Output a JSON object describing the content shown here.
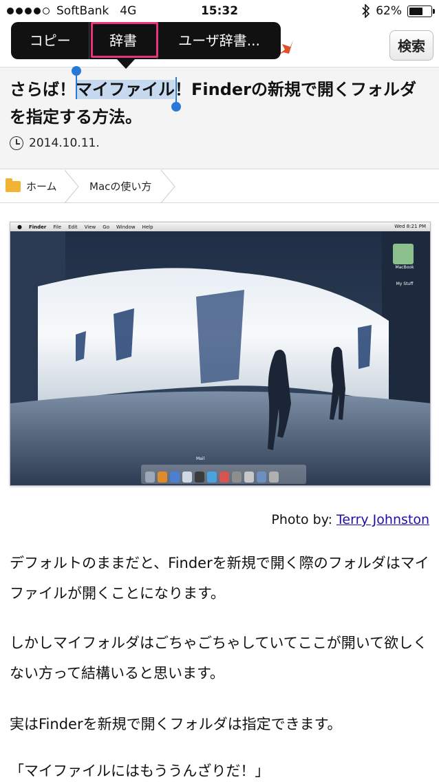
{
  "status_bar": {
    "carrier": "SoftBank",
    "network": "4G",
    "time": "15:32",
    "battery_percent": "62%",
    "battery_level": 0.62,
    "icons": [
      "signal-icon",
      "bluetooth-icon",
      "battery-icon"
    ]
  },
  "edit_menu": {
    "items": [
      "コピー",
      "辞書",
      "ユーザ辞書..."
    ],
    "highlighted_item": "辞書",
    "highlight_color": "#e8347a"
  },
  "header": {
    "search_label": "検索"
  },
  "article": {
    "title_before": "さらば！",
    "title_selected": "マイファイル",
    "title_after": "！Finderの新規で開くフォルダを指定する方法。",
    "date": "2014.10.11."
  },
  "breadcrumb": {
    "home": "ホーム",
    "category": "Macの使い方"
  },
  "photo": {
    "menubar": [
      "Finder",
      "File",
      "Edit",
      "View",
      "Go",
      "Window",
      "Help"
    ],
    "menubar_right": "Wed 8:21 PM",
    "desktop_icons": [
      "MacBook",
      "My Stuff"
    ],
    "dock_label": "Mail",
    "credit_prefix": "Photo by: ",
    "credit_link": "Terry Johnston"
  },
  "paragraphs": [
    "デフォルトのままだと、Finderを新規で開く際のフォルダはマイファイルが開くことになります。",
    "しかしマイフォルダはごちゃごちゃしていてここが開いて欲しくない方って結構いると思います。",
    "実はFinderを新規で開くフォルダは指定できます。",
    "「マイファイルにはもううんざりだ！」"
  ],
  "colors": {
    "selection": "#c6d9ee",
    "selection_handle": "#2979d8",
    "link": "#1a0dab"
  }
}
